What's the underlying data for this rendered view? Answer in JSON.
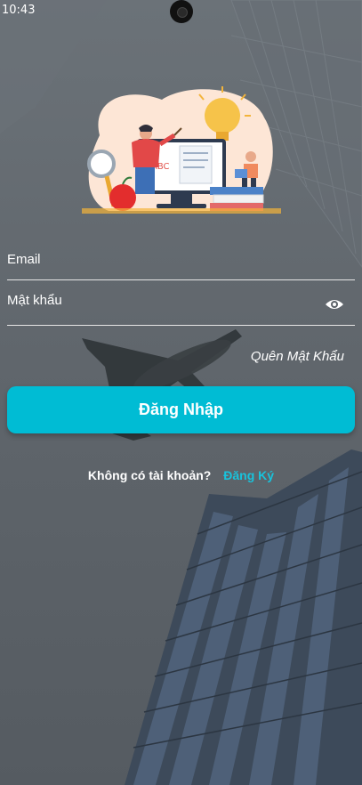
{
  "status_bar": {
    "time": "10:43"
  },
  "form": {
    "email_label": "Email",
    "password_label": "Mật khẩu",
    "forgot_password": "Quên Mật Khẩu",
    "login_button": "Đăng Nhập",
    "no_account": "Không có tài khoản?",
    "signup_link": "Đăng Ký"
  },
  "colors": {
    "accent": "#00bcd4",
    "link": "#18c3dc",
    "text": "#ffffff"
  },
  "icons": {
    "password_toggle": "eye-icon"
  }
}
